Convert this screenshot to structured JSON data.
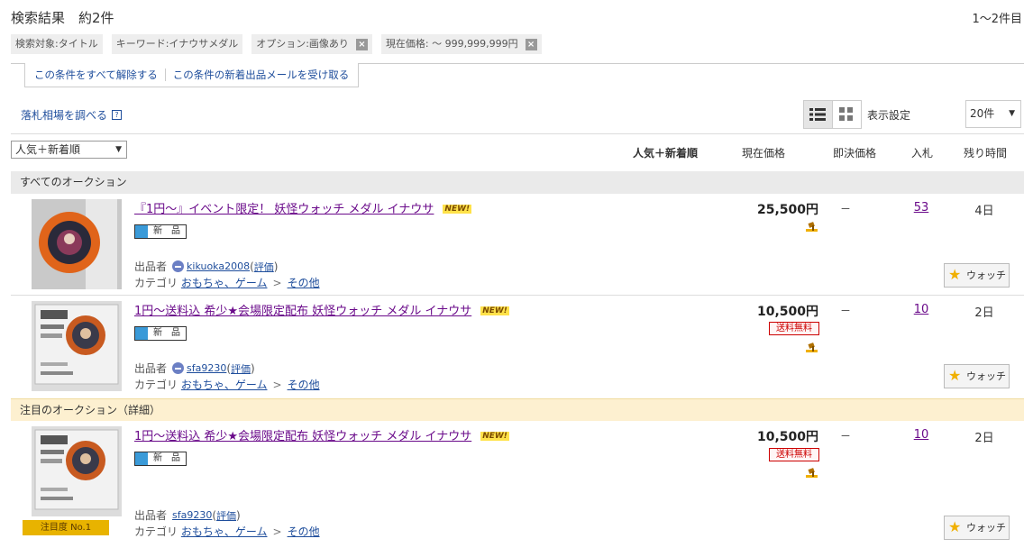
{
  "header": {
    "title": "検索結果　約2件",
    "range": "1〜2件目"
  },
  "chips": [
    {
      "label": "検索対象:タイトル",
      "removable": false
    },
    {
      "label": "キーワード:イナウサメダル",
      "removable": false
    },
    {
      "label": "オプション:画像あり",
      "removable": true
    },
    {
      "label": "現在価格: 〜 999,999,999円",
      "removable": true
    }
  ],
  "conditions": {
    "clear_all": "この条件をすべて解除する",
    "new_mail": "この条件の新着出品メールを受け取る"
  },
  "toolbar": {
    "market_price": "落札相場を調べる",
    "help_icon": "?",
    "display_settings": "表示設定",
    "per_page": "20件"
  },
  "sort": {
    "selected": "人気＋新着順"
  },
  "columns": {
    "sort_label": "人気＋新着順",
    "current_price": "現在価格",
    "buyout": "即決価格",
    "bids": "入札",
    "time_left": "残り時間"
  },
  "sections": {
    "all": "すべてのオークション",
    "featured": "注目のオークション（詳細）"
  },
  "labels": {
    "seller": "出品者",
    "category": "カテゴリ",
    "rating": "評価",
    "new_badge": "NEW!",
    "condition": "新　品",
    "watch": "ウォッチ",
    "free_shipping": "送料無料",
    "featured_ribbon": "注目度 No.1"
  },
  "items": [
    {
      "title": "『1円〜』イベント限定！ 妖怪ウォッチ メダル イナウサ",
      "seller": "kikuoka2008",
      "cat1": "おもちゃ、ゲーム",
      "cat2": "その他",
      "price": "25,500円",
      "buyout": "－",
      "bids": "53",
      "time_left": "4日",
      "free_shipping": false
    },
    {
      "title": "1円〜送料込 希少★会場限定配布 妖怪ウォッチ メダル イナウサ",
      "seller": "sfa9230",
      "cat1": "おもちゃ、ゲーム",
      "cat2": "その他",
      "price": "10,500円",
      "buyout": "－",
      "bids": "10",
      "time_left": "2日",
      "free_shipping": true
    },
    {
      "title": "1円〜送料込 希少★会場限定配布 妖怪ウォッチ メダル イナウサ",
      "seller": "sfa9230",
      "cat1": "おもちゃ、ゲーム",
      "cat2": "その他",
      "price": "10,500円",
      "buyout": "－",
      "bids": "10",
      "time_left": "2日",
      "free_shipping": true
    }
  ],
  "colors": {
    "link": "#1f4e9c",
    "visited": "#6a0a8a",
    "section_gray": "#eaeaea",
    "section_featured": "#fdf0d0"
  }
}
